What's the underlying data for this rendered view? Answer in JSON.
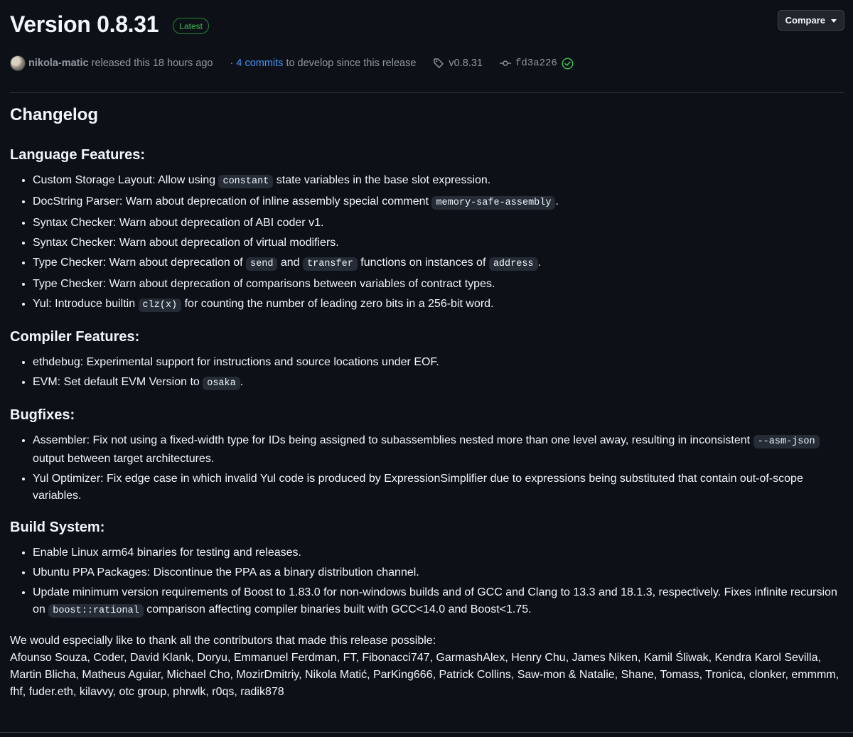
{
  "header": {
    "title": "Version 0.8.31",
    "badge": "Latest",
    "compare_label": "Compare",
    "author": "nikola-matic",
    "released_text": "released this 18 hours ago",
    "commits_link": "4 commits",
    "commits_suffix": "to develop since this release",
    "tag": "v0.8.31",
    "commit_sha": "fd3a226"
  },
  "body": {
    "heading": "Changelog",
    "language_features": {
      "heading": "Language Features:",
      "items": {
        "i0": {
          "a": "Custom Storage Layout: Allow using ",
          "code": "constant",
          "b": " state variables in the base slot expression."
        },
        "i1": {
          "a": "DocString Parser: Warn about deprecation of inline assembly special comment ",
          "code": "memory-safe-assembly",
          "b": "."
        },
        "i2": "Syntax Checker: Warn about deprecation of ABI coder v1.",
        "i3": "Syntax Checker: Warn about deprecation of virtual modifiers.",
        "i4": {
          "a": "Type Checker: Warn about deprecation of ",
          "code1": "send",
          "b": " and ",
          "code2": "transfer",
          "c": " functions on instances of ",
          "code3": "address",
          "d": "."
        },
        "i5": "Type Checker: Warn about deprecation of comparisons between variables of contract types.",
        "i6": {
          "a": "Yul: Introduce builtin ",
          "code": "clz(x)",
          "b": " for counting the number of leading zero bits in a 256-bit word."
        }
      }
    },
    "compiler_features": {
      "heading": "Compiler Features:",
      "items": {
        "i0": "ethdebug: Experimental support for instructions and source locations under EOF.",
        "i1": {
          "a": "EVM: Set default EVM Version to ",
          "code": "osaka",
          "b": "."
        }
      }
    },
    "bugfixes": {
      "heading": "Bugfixes:",
      "items": {
        "i0": {
          "a": "Assembler: Fix not using a fixed-width type for IDs being assigned to subassemblies nested more than one level away, resulting in inconsistent ",
          "code": "--asm-json",
          "b": " output between target architectures."
        },
        "i1": "Yul Optimizer: Fix edge case in which invalid Yul code is produced by ExpressionSimplifier due to expressions being substituted that contain out-of-scope variables."
      }
    },
    "build_system": {
      "heading": "Build System:",
      "items": {
        "i0": "Enable Linux arm64 binaries for testing and releases.",
        "i1": "Ubuntu PPA Packages: Discontinue the PPA as a binary distribution channel.",
        "i2": {
          "a": "Update minimum version requirements of Boost to 1.83.0 for non-windows builds and of GCC and Clang to 13.3 and 18.1.3, respectively. Fixes infinite recursion on ",
          "code": "boost::rational",
          "b": " comparison affecting compiler binaries built with GCC<14.0 and Boost<1.75."
        }
      }
    },
    "thanks_intro": "We would especially like to thank all the contributors that made this release possible:",
    "contributors": "Afounso Souza, Coder, David Klank, Doryu, Emmanuel Ferdman, FT, Fibonacci747, GarmashAlex, Henry Chu, James Niken, Kamil Śliwak, Kendra Karol Sevilla, Martin Blicha, Matheus Aguiar, Michael Cho, MozirDmitriy, Nikola Matić, ParKing666, Patrick Collins, Saw-mon & Natalie, Shane, Tomass, Tronica, clonker, emmmm, fhf, fuder.eth, kilavvy, otc group, phrwlk, r0qs, radik878"
  },
  "icons": {
    "tag": "tag-icon",
    "commit": "git-commit-icon",
    "verified": "check-circle-icon",
    "caret": "triangle-down-icon"
  },
  "colors": {
    "background": "#0d1117",
    "text": "#f0f6fc",
    "muted": "#9198a1",
    "link": "#4493f8",
    "success": "#3fb950",
    "code_bg": "#262c36"
  }
}
